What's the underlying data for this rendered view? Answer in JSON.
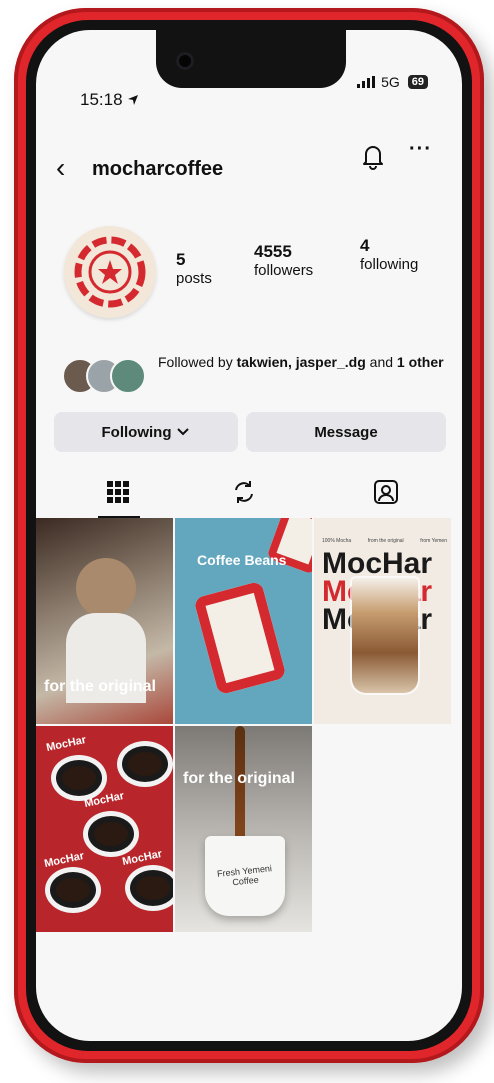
{
  "status_bar": {
    "time": "15:18",
    "network": "5G",
    "battery": "69"
  },
  "profile": {
    "username": "mocharcoffee",
    "stats": {
      "posts": {
        "value": "5",
        "label": "posts"
      },
      "followers": {
        "value": "4555",
        "label": "followers"
      },
      "following": {
        "value": "4",
        "label": "following"
      }
    },
    "followed_by": {
      "prefix": "Followed by ",
      "users": "takwien, jasper_.dg",
      "middle": " and ",
      "count": "1",
      "suffix": " other"
    }
  },
  "actions": {
    "following_label": "Following",
    "message_label": "Message"
  },
  "tabs": [
    "grid",
    "reels",
    "tagged"
  ],
  "posts": [
    {
      "caption": "for the original"
    },
    {
      "caption": "Coffee Beans"
    },
    {
      "brand_lines": [
        "MocHar",
        "MocHar",
        "MocHar"
      ],
      "top_labels": [
        "100% Mocha",
        "from the original",
        "from Yemen"
      ]
    },
    {
      "cup_labels": [
        "MocHar",
        "MocHar",
        "MocHar",
        "MocHar"
      ]
    },
    {
      "caption": "for the original",
      "mug_text": "Fresh Yemeni Coffee"
    }
  ],
  "colors": {
    "brand_red": "#d42a2f",
    "frame_red": "#e0262a",
    "sky_blue": "#63a7bf",
    "cream": "#f2e7d8"
  }
}
